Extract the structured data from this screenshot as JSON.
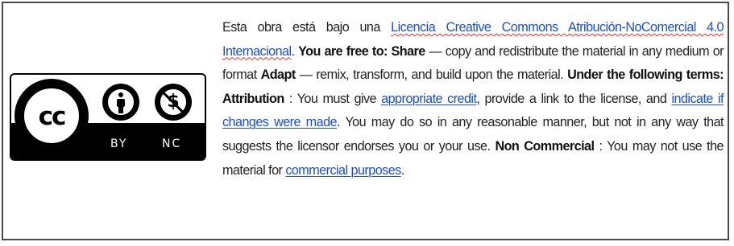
{
  "badge": {
    "cc_mark": "cc",
    "term_icons": [
      "attribution-icon",
      "noncommercial-icon"
    ],
    "labels": {
      "by": "BY",
      "nc": "NC"
    }
  },
  "license": {
    "intro": "Esta obra está bajo una ",
    "license_link": "Licencia Creative Commons Atribución-NoComercial 4.0 Internacional",
    "after_link": ". ",
    "free_heading": "You are free to: Share",
    "share_text": " — copy and redistribute the material in any medium or format ",
    "adapt_heading": "Adapt",
    "adapt_text": " — remix, transform, and build upon the material. ",
    "terms_heading": "Under the following terms: Attribution",
    "attribution_text": " : You must give ",
    "credit_link": "appropriate credit",
    "credit_after": ", provide a link to the license, and ",
    "changes_link": "indicate if changes were made",
    "changes_after": ". You may do so in any reasonable manner, but not in any way that suggests the licensor endorses you or your use. ",
    "nc_heading": "Non Commercial",
    "nc_text": " : You may not use the material for ",
    "purposes_link": "commercial purposes",
    "end": "."
  },
  "colors": {
    "link": "#1d4fbf",
    "text": "#222222",
    "border": "#4a4a4a",
    "badge": "#000000"
  }
}
